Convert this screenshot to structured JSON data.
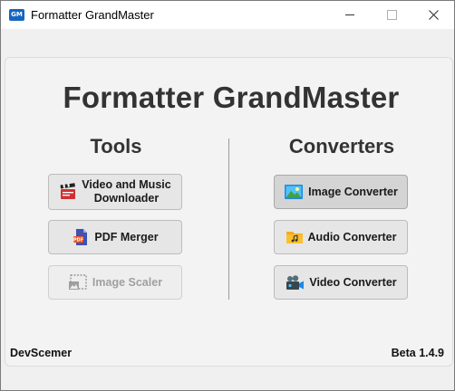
{
  "window": {
    "icon_text": "GM",
    "title": "Formatter GrandMaster"
  },
  "main": {
    "title": "Formatter GrandMaster"
  },
  "tools": {
    "heading": "Tools",
    "video_music_label_line1": "Video and Music",
    "video_music_label_line2": "Downloader",
    "pdf_merger_label": "PDF Merger",
    "image_scaler_label": "Image Scaler"
  },
  "converters": {
    "heading": "Converters",
    "image_label": "Image Converter",
    "audio_label": "Audio Converter",
    "video_label": "Video Converter"
  },
  "footer": {
    "author": "DevScemer",
    "version": "Beta 1.4.9"
  },
  "icons": {
    "video_music": "clapperboard-icon",
    "pdf": "pdf-file-icon",
    "scaler": "image-crop-icon",
    "image": "picture-icon",
    "audio": "music-folder-icon",
    "video": "camera-icon"
  },
  "colors": {
    "title_text": "#333333",
    "button_bg": "#e6e6e6",
    "selected_button_bg": "#d4d4d4",
    "disabled_text": "#a0a0a0"
  }
}
